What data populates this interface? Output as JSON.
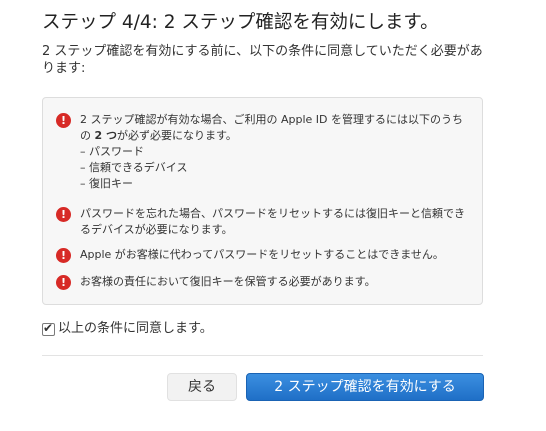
{
  "heading": "ステップ 4/4: 2 ステップ確認を有効にします。",
  "intro": "2 ステップ確認を有効にする前に、以下の条件に同意していただく必要があります:",
  "notices": [
    {
      "icon": "exclamation-circle-icon",
      "text_before": "2 ステップ確認が有効な場合、ご利用の Apple ID を管理するには以下のうちの ",
      "text_bold": "2 つ",
      "text_after": "が必ず必要になります。",
      "requirements": [
        "– パスワード",
        "– 信頼できるデバイス",
        "– 復旧キー"
      ]
    },
    {
      "icon": "exclamation-circle-icon",
      "text": "パスワードを忘れた場合、パスワードをリセットするには復旧キーと信頼できるデバイスが必要になります。"
    },
    {
      "icon": "exclamation-circle-icon",
      "text": "Apple がお客様に代わってパスワードをリセットすることはできません。"
    },
    {
      "icon": "exclamation-circle-icon",
      "text": "お客様の責任において復旧キーを保管する必要があります。"
    }
  ],
  "agree": {
    "label": "以上の条件に同意します。",
    "checked": true
  },
  "buttons": {
    "back": "戻る",
    "enable": "2 ステップ確認を有効にする"
  },
  "colors": {
    "warning_icon": "#d72a26",
    "primary_button": "#2478d4",
    "notice_background": "#f7f7f7"
  }
}
